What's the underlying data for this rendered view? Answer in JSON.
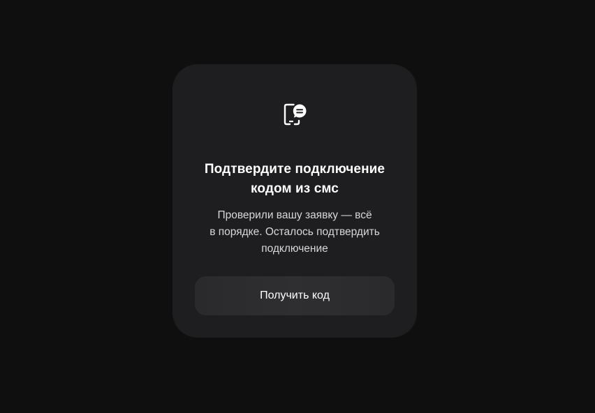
{
  "modal": {
    "icon": "phone-sms-icon",
    "title_line1": "Подтвердите подключение",
    "title_line2": "кодом из смс",
    "description_line1": "Проверили вашу заявку — всё",
    "description_line2": "в порядке. Осталось подтвердить",
    "description_line3": "подключение",
    "button_label": "Получить код"
  },
  "colors": {
    "page_background": "#0f0f0f",
    "card_background": "#1e1e20",
    "button_background": "#2c2c2e",
    "text_primary": "#ffffff",
    "text_secondary": "#d8d8da"
  }
}
